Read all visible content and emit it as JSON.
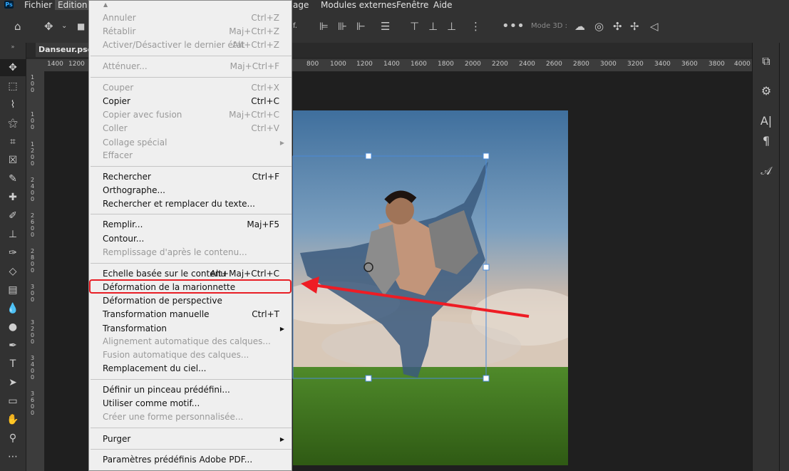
{
  "menubar": {
    "logo": "Ps",
    "items": [
      "Fichier",
      "Edition",
      "age",
      "Modules externes",
      "Fenêtre",
      "Aide"
    ]
  },
  "options_bar": {
    "f_label": "f.",
    "mode3d": "Mode 3D :"
  },
  "document": {
    "tab_title": "Danseur.psd @"
  },
  "ruler": {
    "top_left": [
      "1400",
      "1200"
    ],
    "top": [
      "800",
      "1000",
      "1200",
      "1400",
      "1600",
      "1800",
      "2000",
      "2200",
      "2400",
      "2600",
      "2800",
      "3000",
      "3200",
      "3400",
      "3600",
      "3800",
      "4000"
    ],
    "left": [
      "1",
      "0",
      "0",
      "1",
      "0",
      "0",
      "1",
      "2",
      "0",
      "0",
      "2",
      "4",
      "0",
      "0",
      "2",
      "6",
      "0",
      "0",
      "2",
      "8",
      "0",
      "0",
      "3",
      "0",
      "0",
      "3",
      "2",
      "0",
      "0",
      "3",
      "4",
      "0",
      "0",
      "3",
      "6",
      "0",
      "0"
    ]
  },
  "menu": {
    "items": [
      {
        "label": "Annuler",
        "shortcut": "Ctrl+Z",
        "disabled": true
      },
      {
        "label": "Rétablir",
        "shortcut": "Maj+Ctrl+Z",
        "disabled": true
      },
      {
        "label": "Activer/Désactiver le dernier état",
        "shortcut": "Alt+Ctrl+Z",
        "disabled": true
      },
      {
        "label": "Atténuer...",
        "shortcut": "Maj+Ctrl+F",
        "disabled": true
      },
      {
        "label": "Couper",
        "shortcut": "Ctrl+X",
        "disabled": true
      },
      {
        "label": "Copier",
        "shortcut": "Ctrl+C",
        "disabled": false
      },
      {
        "label": "Copier avec fusion",
        "shortcut": "Maj+Ctrl+C",
        "disabled": true
      },
      {
        "label": "Coller",
        "shortcut": "Ctrl+V",
        "disabled": true
      },
      {
        "label": "Collage spécial",
        "shortcut": "",
        "disabled": true
      },
      {
        "label": "Effacer",
        "shortcut": "",
        "disabled": true
      },
      {
        "label": "Rechercher",
        "shortcut": "Ctrl+F",
        "disabled": false
      },
      {
        "label": "Orthographe...",
        "shortcut": "",
        "disabled": false
      },
      {
        "label": "Rechercher et remplacer du texte...",
        "shortcut": "",
        "disabled": false
      },
      {
        "label": "Remplir...",
        "shortcut": "Maj+F5",
        "disabled": false
      },
      {
        "label": "Contour...",
        "shortcut": "",
        "disabled": false
      },
      {
        "label": "Remplissage d'après le contenu...",
        "shortcut": "",
        "disabled": true
      },
      {
        "label": "Echelle basée sur le contenu",
        "shortcut": "Alt+Maj+Ctrl+C",
        "disabled": false
      },
      {
        "label": "Déformation de la marionnette",
        "shortcut": "",
        "disabled": false
      },
      {
        "label": "Déformation de perspective",
        "shortcut": "",
        "disabled": false
      },
      {
        "label": "Transformation manuelle",
        "shortcut": "Ctrl+T",
        "disabled": false
      },
      {
        "label": "Transformation",
        "shortcut": "",
        "disabled": false
      },
      {
        "label": "Alignement automatique des calques...",
        "shortcut": "",
        "disabled": true
      },
      {
        "label": "Fusion automatique des calques...",
        "shortcut": "",
        "disabled": true
      },
      {
        "label": "Remplacement du ciel...",
        "shortcut": "",
        "disabled": false
      },
      {
        "label": "Définir un pinceau prédéfini...",
        "shortcut": "",
        "disabled": false
      },
      {
        "label": "Utiliser comme motif...",
        "shortcut": "",
        "disabled": false
      },
      {
        "label": "Créer une forme personnalisée...",
        "shortcut": "",
        "disabled": true
      },
      {
        "label": "Purger",
        "shortcut": "",
        "disabled": false
      },
      {
        "label": "Paramètres prédéfinis Adobe PDF...",
        "shortcut": "",
        "disabled": false
      }
    ]
  },
  "colors": {
    "accent_red": "#e81e25",
    "menu_bg": "#efefef",
    "panel_bg": "#323232"
  }
}
